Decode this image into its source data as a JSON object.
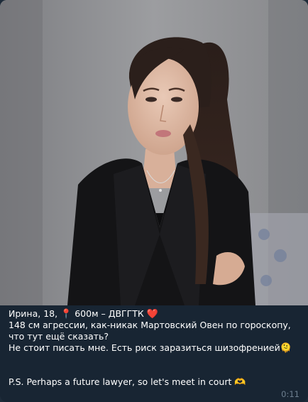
{
  "message": {
    "line1_name": "Ирина, 18, ",
    "line1_pin": "📍",
    "line1_place": " 600м – ДВГГТК ",
    "line1_heart": "❤️",
    "line2": "148 см агрессии, как-никак Мартовский Овен по гороскопу, что тут ещё сказать?",
    "line3": "Не стоит писать мне. Есть риск заразиться шизофренией",
    "line3_emoji": "🫠",
    "line4": "P.S. Perhaps a future lawyer, so let's meet in court ",
    "line4_emoji": "🫶",
    "time": "0:11"
  },
  "photo": {
    "icon": "photo-of-woman"
  },
  "colors": {
    "bubble": "#182533",
    "text": "#ffffff",
    "time": "#6d7f8f"
  }
}
